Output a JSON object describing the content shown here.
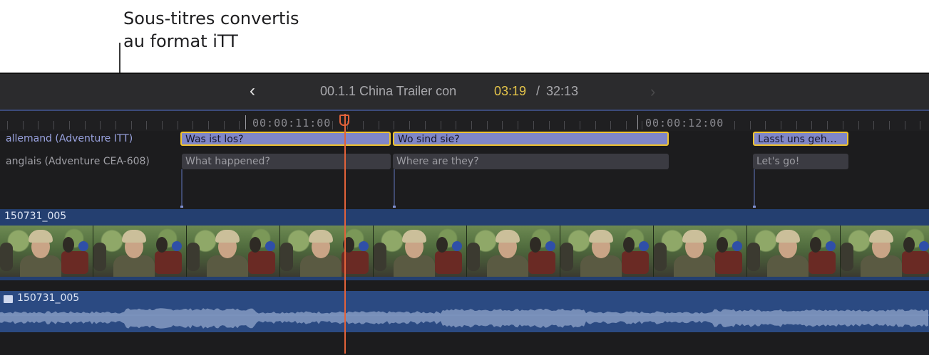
{
  "callout": {
    "line1": "Sous-titres convertis",
    "line2": "au format iTT"
  },
  "toolbar": {
    "back_icon": "chevron-left-icon",
    "forward_icon": "chevron-right-icon",
    "project_title": "00.1.1 China Trailer con",
    "current_timecode": "03:19",
    "separator": "/",
    "total_duration": "32:13"
  },
  "ruler": {
    "labels": [
      "00:00:11:00",
      "00:00:12:00"
    ]
  },
  "caption_lanes": [
    {
      "label": "allemand (Adventure ITT)",
      "captions": [
        "Was ist los?",
        "Wo sind sie?",
        "Lasst uns geh…"
      ]
    },
    {
      "label": "anglais (Adventure CEA-608)",
      "captions": [
        "What happened?",
        "Where are they?",
        "Let's go!"
      ]
    }
  ],
  "video_clip": {
    "name": "150731_005"
  },
  "audio_clip": {
    "name": "150731_005",
    "icon": "film-icon"
  },
  "colors": {
    "playhead": "#e2623a",
    "timecode": "#e4c44a",
    "selected_caption_border": "#f0c330",
    "itt_caption_fill": "#7f86c8",
    "video_clip": "#243f70",
    "audio_clip": "#2b4a82"
  }
}
